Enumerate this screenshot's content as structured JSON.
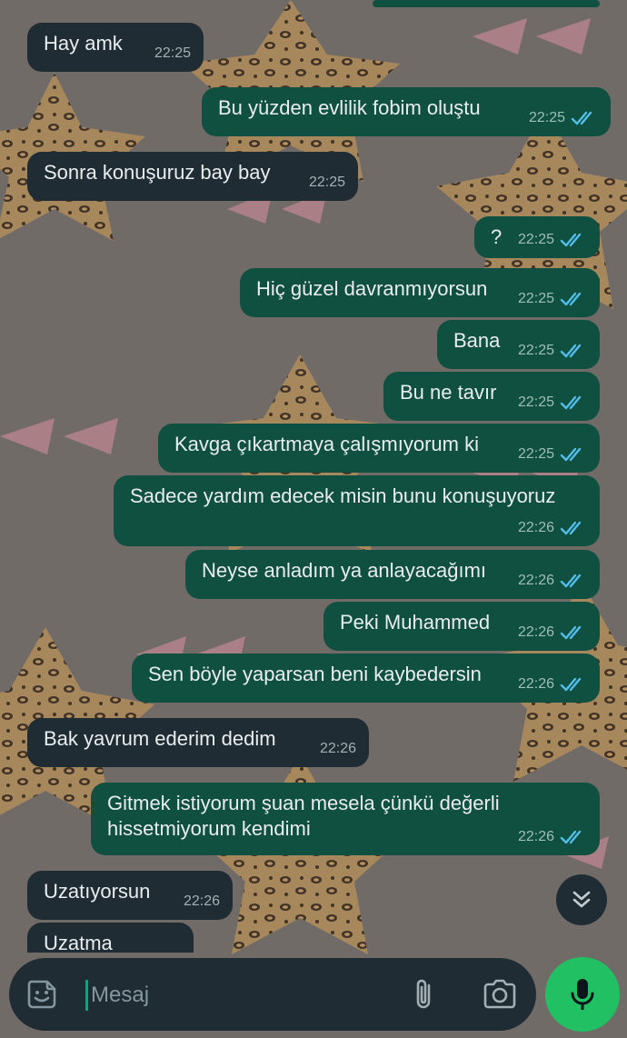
{
  "colors": {
    "incoming_bubble": "#1f2c33",
    "outgoing_bubble": "#0f5040",
    "read_ticks": "#53bdeb",
    "accent_green": "#21c063"
  },
  "messages": [
    {
      "direction": "in",
      "text": "Hay amk",
      "time": "22:25"
    },
    {
      "direction": "out",
      "text": "Bu yüzden evlilik fobim oluştu",
      "time": "22:25",
      "status": "read"
    },
    {
      "direction": "in",
      "text": "Sonra konuşuruz bay bay",
      "time": "22:25"
    },
    {
      "direction": "out",
      "text": "?",
      "time": "22:25",
      "status": "read"
    },
    {
      "direction": "out",
      "text": "Hiç güzel davranmıyorsun",
      "time": "22:25",
      "status": "read"
    },
    {
      "direction": "out",
      "text": "Bana",
      "time": "22:25",
      "status": "read"
    },
    {
      "direction": "out",
      "text": "Bu ne tavır",
      "time": "22:25",
      "status": "read"
    },
    {
      "direction": "out",
      "text": "Kavga çıkartmaya çalışmıyorum ki",
      "time": "22:25",
      "status": "read"
    },
    {
      "direction": "out",
      "text": "Sadece yardım edecek misin bunu konuşuyoruz",
      "time": "22:26",
      "status": "read"
    },
    {
      "direction": "out",
      "text": "Neyse anladım ya anlayacağımı",
      "time": "22:26",
      "status": "read"
    },
    {
      "direction": "out",
      "text": "Peki Muhammed",
      "time": "22:26",
      "status": "read"
    },
    {
      "direction": "out",
      "text": "Sen böyle yaparsan beni kaybedersin",
      "time": "22:26",
      "status": "read"
    },
    {
      "direction": "in",
      "text": "Bak yavrum ederim dedim",
      "time": "22:26"
    },
    {
      "direction": "out",
      "text": "Gitmek istiyorum şuan mesela çünkü değerli\nhissetmiyorum kendimi",
      "time": "22:26",
      "status": "read"
    },
    {
      "direction": "in",
      "text": "Uzatıyorsun",
      "time": "22:26"
    },
    {
      "direction": "in",
      "text": "Uzatma",
      "time": ""
    }
  ],
  "composer": {
    "placeholder": "Mesaj",
    "emoji_icon": "sticker-icon",
    "attach_icon": "paperclip-icon",
    "camera_icon": "camera-icon",
    "send_icon": "microphone-icon"
  },
  "scroll_button": {
    "icon": "double-chevron-down-icon"
  }
}
